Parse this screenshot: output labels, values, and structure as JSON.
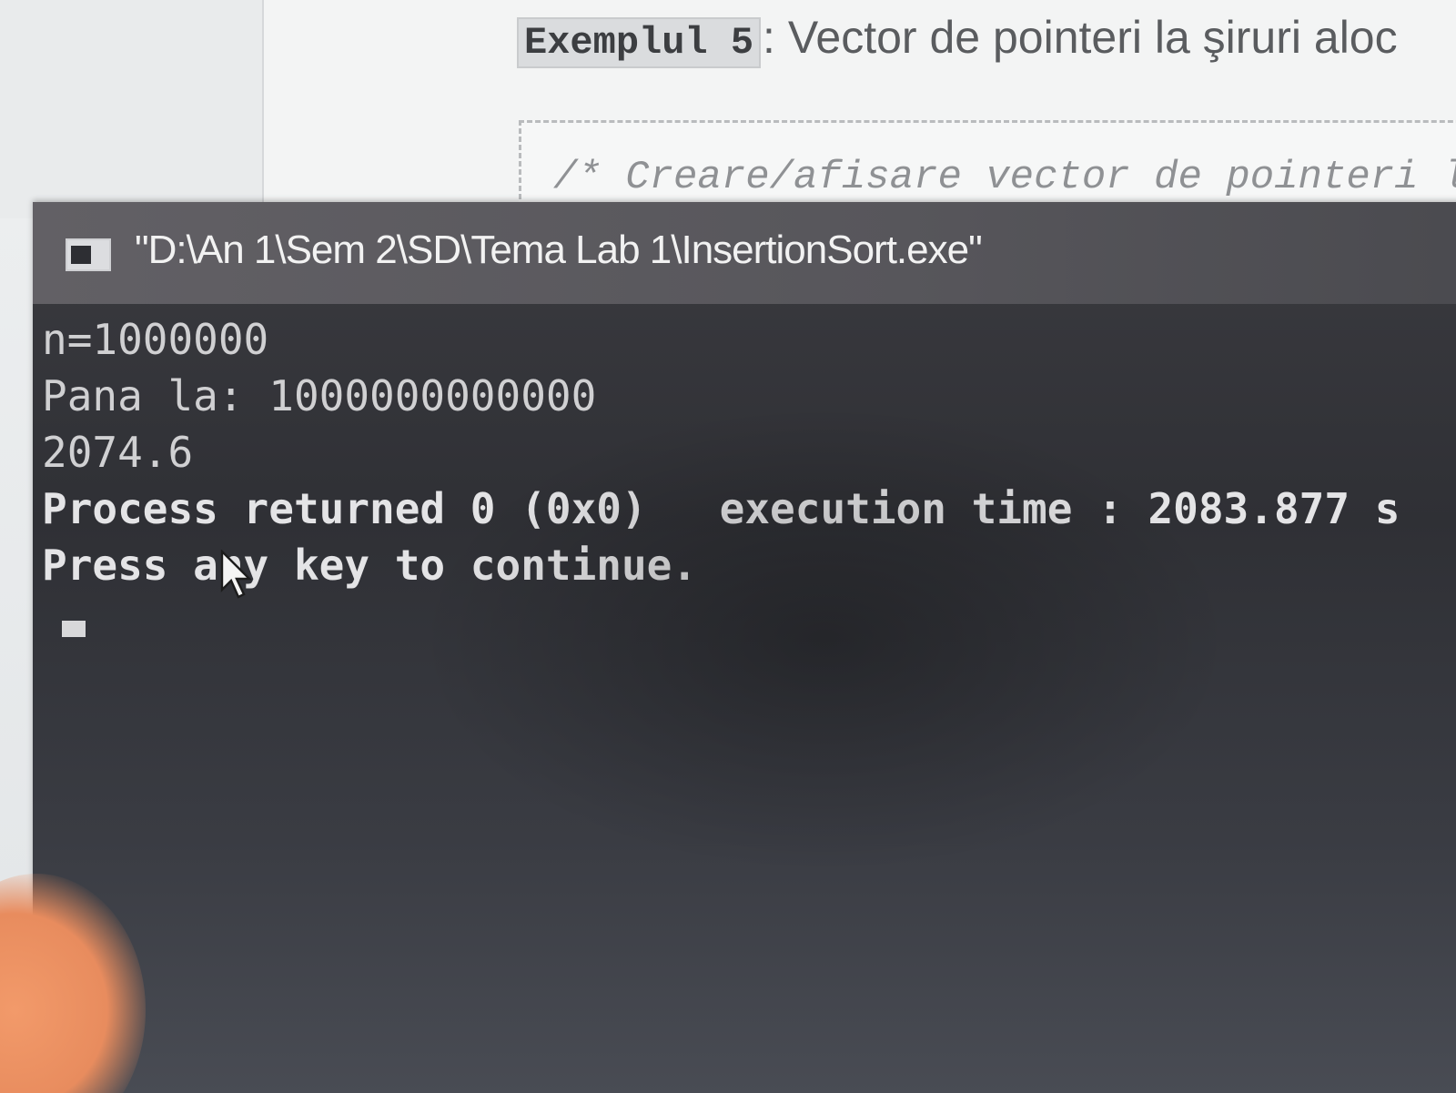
{
  "document": {
    "heading_label": "Exemplul 5",
    "heading_text": ": Vector de pointeri la şiruri aloc",
    "code_comment": "/* Creare/afisare vector de pointeri la"
  },
  "console": {
    "title": "\"D:\\An 1\\Sem 2\\SD\\Tema Lab 1\\InsertionSort.exe\"",
    "icon": "console-window-icon",
    "lines": [
      "n=1000000",
      "Pana la: 1000000000000",
      "2074.6"
    ],
    "process_returned": "Process returned 0 (0x0)",
    "execution_time": "execution time : 2083.877 s",
    "press_key": "Press any key to continue."
  },
  "colors": {
    "console_background": "#2f3035",
    "console_titlebar": "#57565b",
    "console_text": "#d0d0d2"
  }
}
